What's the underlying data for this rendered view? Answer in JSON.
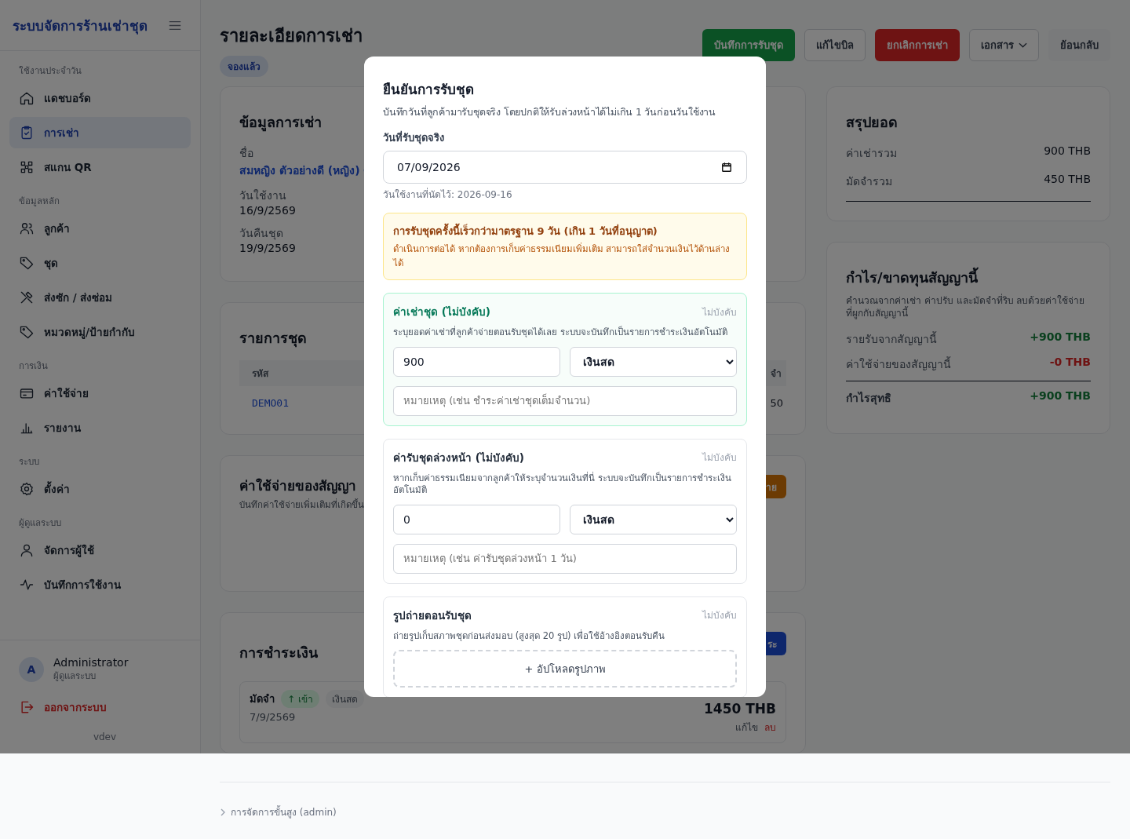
{
  "sidebar": {
    "title": "ระบบจัดการร้านเช่าชุด",
    "sections": [
      {
        "heading": "ใช้งานประจำวัน",
        "items": [
          {
            "label": "แดชบอร์ด",
            "selected": false
          },
          {
            "label": "การเช่า",
            "selected": true
          },
          {
            "label": "สแกน QR",
            "selected": false
          }
        ]
      },
      {
        "heading": "ข้อมูลหลัก",
        "items": [
          {
            "label": "ลูกค้า",
            "selected": false
          },
          {
            "label": "ชุด",
            "selected": false
          },
          {
            "label": "ส่งซัก / ส่งซ่อม",
            "selected": false
          },
          {
            "label": "หมวดหมู่/ป้ายกำกับ",
            "selected": false
          }
        ]
      },
      {
        "heading": "การเงิน",
        "items": [
          {
            "label": "ค่าใช้จ่าย",
            "selected": false
          },
          {
            "label": "รายงาน",
            "selected": false
          }
        ]
      },
      {
        "heading": "ระบบ",
        "items": [
          {
            "label": "ตั้งค่า",
            "selected": false
          }
        ]
      },
      {
        "heading": "ผู้ดูแลระบบ",
        "items": [
          {
            "label": "จัดการผู้ใช้",
            "selected": false
          },
          {
            "label": "บันทึกการใช้งาน",
            "selected": false
          }
        ]
      }
    ],
    "user": {
      "initial": "A",
      "name": "Administrator",
      "role": "ผู้ดูแลระบบ"
    },
    "logout": "ออกจากระบบ",
    "version": "vdev"
  },
  "header": {
    "title": "รายละเอียดการเช่า",
    "status_badge": "จองแล้ว",
    "buttons": [
      {
        "label": "บันทึกการรับชุด",
        "kind": "success"
      },
      {
        "label": "แก้ไขบิล",
        "kind": "outline"
      },
      {
        "label": "ยกเลิกการเช่า",
        "kind": "danger"
      },
      {
        "label": "เอกสาร",
        "kind": "dropdown"
      },
      {
        "label": "ย้อนกลับ",
        "kind": "secondary"
      }
    ]
  },
  "rental_info": {
    "title": "ข้อมูลการเช่า",
    "fields": [
      {
        "label": "ชื่อ",
        "value": "สมหญิง ตัวอย่างดี (หญิง)",
        "kind": "link"
      },
      {
        "label": "วันใช้งาน",
        "value": "16/9/2569",
        "kind": "text"
      },
      {
        "label": "วันคืนชุด",
        "value": "19/9/2569",
        "kind": "text"
      }
    ]
  },
  "items_table": {
    "title": "รายการชุด",
    "columns": [
      "รหัส",
      "จำ"
    ],
    "rows": [
      [
        "DEMO01",
        "50"
      ]
    ]
  },
  "expenses": {
    "title": "ค่าใช้จ่ายของสัญญา",
    "subtitle": "บันทึกค่าใช้จ่ายเพิ่มเติมที่เกิดขึ้น",
    "button": "าย"
  },
  "payments": {
    "title": "การชำระเงิน",
    "button": "ระ",
    "items": [
      {
        "type": "มัดจำ",
        "direction": "↑ เข้า",
        "method": "เงินสด",
        "date": "7/9/2569",
        "amount": "1450 THB",
        "edit": "แก้ไข",
        "delete": "ลบ"
      }
    ]
  },
  "summary": {
    "title": "สรุปยอด",
    "rows": [
      {
        "label": "ค่าเช่ารวม",
        "value": "900 THB"
      },
      {
        "label": "มัดจำรวม",
        "value": "450 THB"
      }
    ]
  },
  "profit": {
    "title": "กำไร/ขาดทุนสัญญานี้",
    "description": "คำนวณจากค่าเช่า ค่าปรับ และมัดจำที่ริบ ลบด้วยค่าใช้จ่ายที่ผูกกับสัญญานี้",
    "rows": [
      {
        "label": "รายรับจากสัญญานี้",
        "value": "+900 THB",
        "kind": "income"
      },
      {
        "label": "ค่าใช้จ่ายของสัญญานี้",
        "value": "-0 THB",
        "kind": "expense"
      }
    ],
    "net": {
      "label": "กำไรสุทธิ",
      "value": "+900 THB"
    }
  },
  "modal": {
    "title": "ยืนยันการรับชุด",
    "description": "บันทึกวันที่ลูกค้ามารับชุดจริง โดยปกติให้รับล่วงหน้าได้ไม่เกิน 1 วันก่อนวันใช้งาน",
    "date_label": "วันที่รับชุดจริง",
    "date_value": "07/09/2026",
    "date_hint": "วันใช้งานที่นัดไว้: 2026-09-16",
    "warning": {
      "title": "การรับชุดครั้งนี้เร็วกว่ามาตรฐาน 9 วัน (เกิน 1 วันที่อนุญาต)",
      "text": "ดำเนินการต่อได้ หากต้องการเก็บค่าธรรมเนียมเพิ่มเติม สามารถใส่จำนวนเงินไว้ด้านล่างได้"
    },
    "fee_sections": [
      {
        "title": "ค่าเช่าชุด (ไม่บังคับ)",
        "optional_tag": "ไม่บังคับ",
        "description": "ระบุยอดค่าเช่าที่ลูกค้าจ่ายตอนรับชุดได้เลย ระบบจะบันทึกเป็นรายการชำระเงินอัตโนมัติ",
        "amount": "900",
        "method": "เงินสด",
        "note_placeholder": "หมายเหตุ (เช่น ชำระค่าเช่าชุดเต็มจำนวน)",
        "highlighted": true
      },
      {
        "title": "ค่ารับชุดล่วงหน้า (ไม่บังคับ)",
        "optional_tag": "ไม่บังคับ",
        "description": "หากเก็บค่าธรรมเนียมจากลูกค้าให้ระบุจำนวนเงินที่นี่ ระบบจะบันทึกเป็นรายการชำระเงินอัตโนมัติ",
        "amount": "0",
        "method": "เงินสด",
        "note_placeholder": "หมายเหตุ (เช่น ค่ารับชุดล่วงหน้า 1 วัน)",
        "highlighted": false
      }
    ],
    "photos": {
      "title": "รูปถ่ายตอนรับชุด",
      "optional_tag": "ไม่บังคับ",
      "description": "ถ่ายรูปเก็บสภาพชุดก่อนส่งมอบ (สูงสุด 20 รูป) เพื่อใช้อ้างอิงตอนรับคืน",
      "upload_label": "+ อัปโหลดรูปภาพ"
    }
  },
  "footer": {
    "breadcrumb": "การจัดการขั้นสูง (admin)"
  }
}
